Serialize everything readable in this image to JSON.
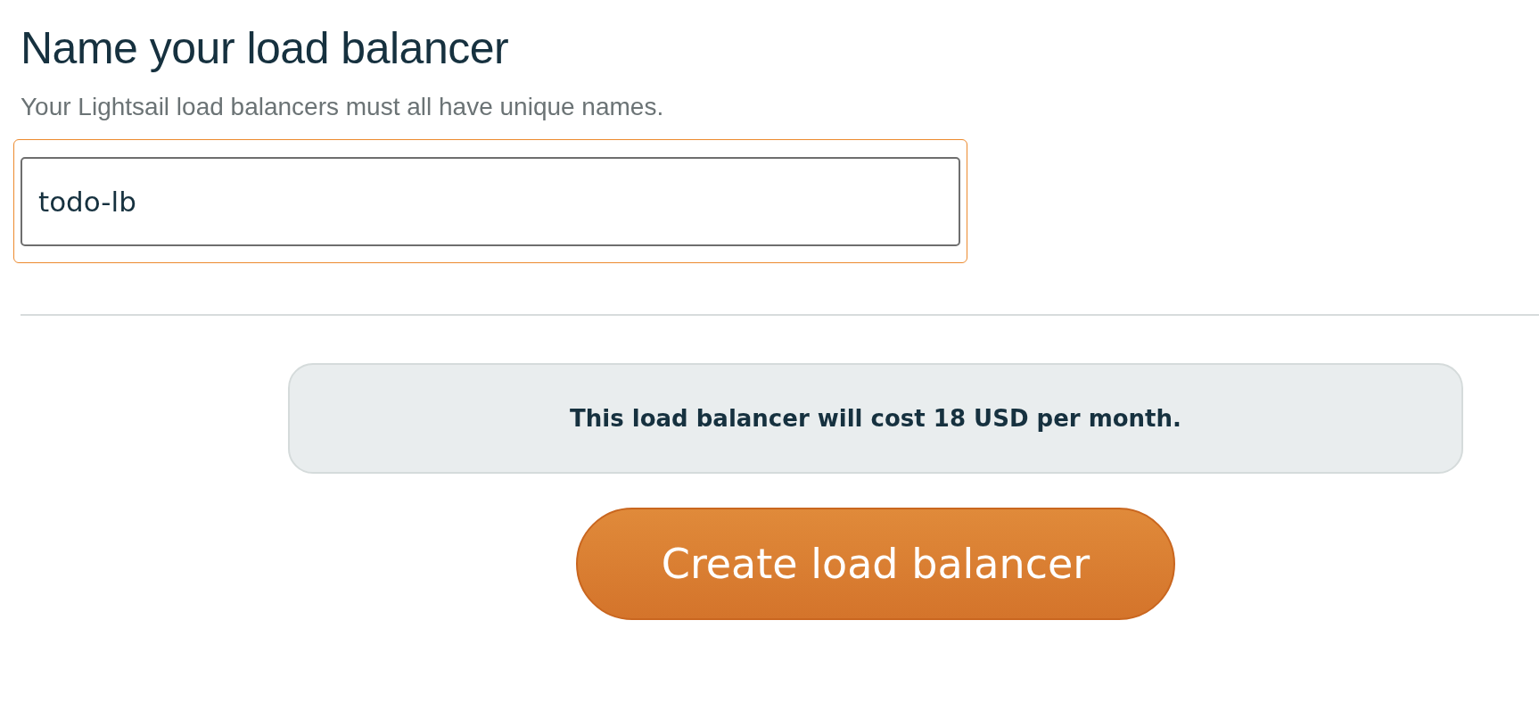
{
  "heading": "Name your load balancer",
  "description": "Your Lightsail load balancers must all have unique names.",
  "name_field": {
    "value": "todo-lb",
    "focused": true
  },
  "cost_notice": "This load balancer will cost 18 USD per month.",
  "create_button": "Create load balancer"
}
